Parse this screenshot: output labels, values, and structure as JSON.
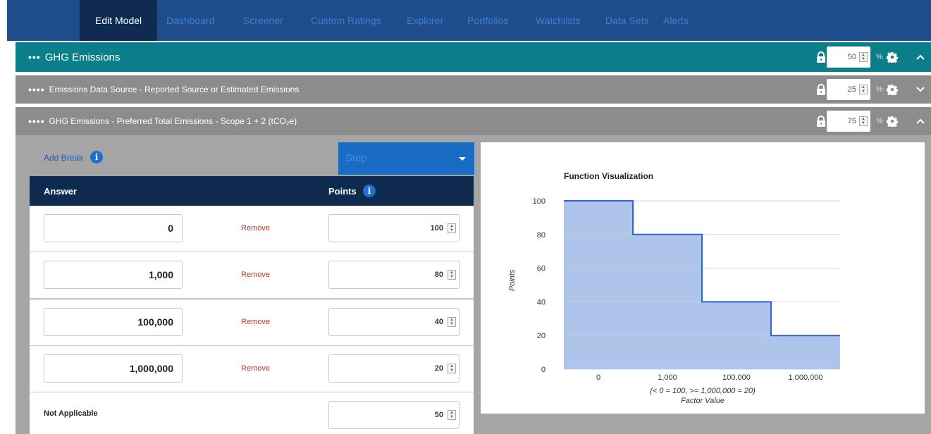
{
  "nav": {
    "tabs": [
      "Edit Model",
      "Dashboard",
      "Screener",
      "Custom Ratings",
      "Explorer",
      "Portfolios",
      "Watchlists",
      "Data Sets",
      "Alerts"
    ],
    "active": "Edit Model"
  },
  "panels": [
    {
      "dots": "•••",
      "title": "GHG Emissions",
      "weight": "50",
      "unit": "%"
    },
    {
      "dots": "••••",
      "title": "Emissions Data Source - Reported Source or Estimated Emissions",
      "weight": "25",
      "unit": "%"
    },
    {
      "dots": "••••",
      "title": "GHG Emissions - Preferred Total Emissions - Scope 1 + 2 (tCO₂e)",
      "weight": "75",
      "unit": "%"
    }
  ],
  "editor": {
    "add_break": "Add Break",
    "function_type": "Step",
    "col_answer": "Answer",
    "col_points": "Points",
    "remove_label": "Remove",
    "rows": [
      {
        "answer": "0",
        "points": "100"
      },
      {
        "answer": "1,000",
        "points": "80"
      },
      {
        "answer": "100,000",
        "points": "40"
      },
      {
        "answer": "1,000,000",
        "points": "20"
      }
    ],
    "not_applicable_label": "Not Applicable",
    "not_applicable_points": "50"
  },
  "colors": {
    "nav": "#1f4d8c",
    "nav_active": "#0e2a4f",
    "teal": "#0a7f8a",
    "gray": "#8c8c8c",
    "accent": "#1e6fd0",
    "remove": "#c0392b",
    "chart_fill": "#aec4ea",
    "chart_line": "#2e66d1"
  },
  "chart_data": {
    "type": "area",
    "title": "Function Visualization",
    "ylabel": "Points",
    "xlabel_note": "(< 0 = 100, >= 1,000,000 = 20)",
    "xlabel": "Factor Value",
    "categories": [
      "0",
      "1,000",
      "100,000",
      "1,000,000"
    ],
    "values": [
      100,
      80,
      40,
      20
    ],
    "yticks": [
      0,
      20,
      40,
      60,
      80,
      100
    ],
    "ylim": [
      0,
      100
    ],
    "step": true,
    "grid": true
  }
}
